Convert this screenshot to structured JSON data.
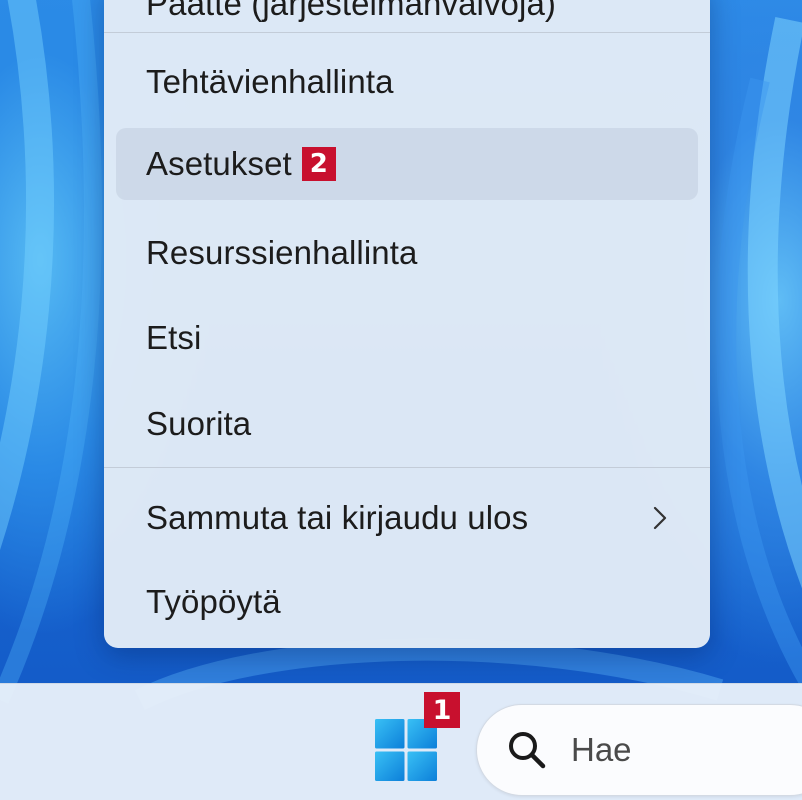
{
  "menu": {
    "partial_top_item": "Päätte (järjestelmänvalvoja)",
    "items": [
      {
        "label": "Tehtävienhallinta"
      },
      {
        "label": "Asetukset",
        "badge": "2"
      },
      {
        "label": "Resurssienhallinta"
      },
      {
        "label": "Etsi"
      },
      {
        "label": "Suorita"
      },
      {
        "label": "Sammuta tai kirjaudu ulos"
      },
      {
        "label": "Työpöytä"
      }
    ]
  },
  "taskbar": {
    "start_badge": "1",
    "search": {
      "placeholder": "Hae"
    }
  },
  "colors": {
    "badge": "#c8102e",
    "menu_background": "#e2ebf6",
    "taskbar_background": "#e8f0fa",
    "windows_logo": "#1a9be6"
  },
  "icons": {
    "start": "windows-logo-icon",
    "search": "search-icon",
    "submenu": "chevron-right-icon"
  }
}
